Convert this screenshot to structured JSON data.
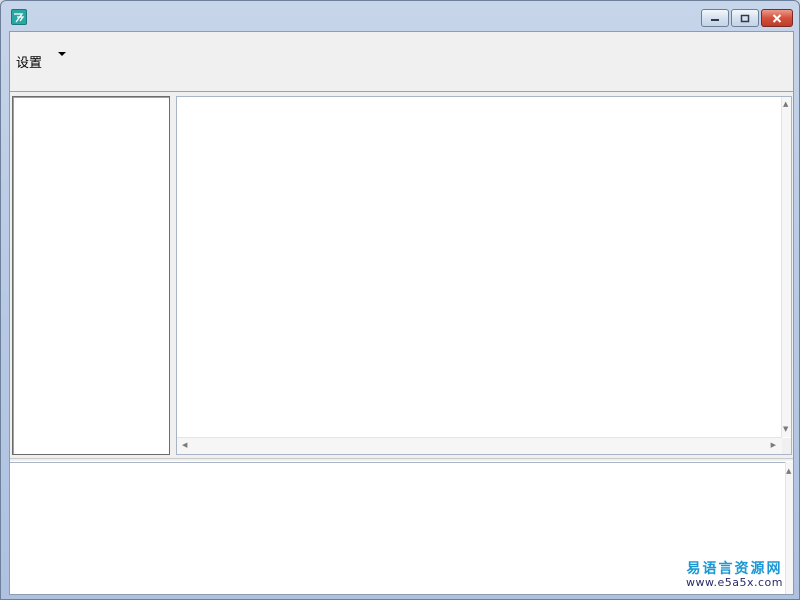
{
  "window": {
    "icon": "app-stripe-icon",
    "controls": {
      "minimize": "minimize-icon",
      "maximize": "maximize-icon",
      "close": "close-icon"
    }
  },
  "toolbar": {
    "settings_label": "设置",
    "settings_arrow": "chevron-down-icon"
  },
  "watermark": {
    "name": "易语言资源网",
    "url": "www.e5a5x.com"
  },
  "colors": {
    "watermark_text": "#1b97d3",
    "close_button": "#c94530"
  }
}
